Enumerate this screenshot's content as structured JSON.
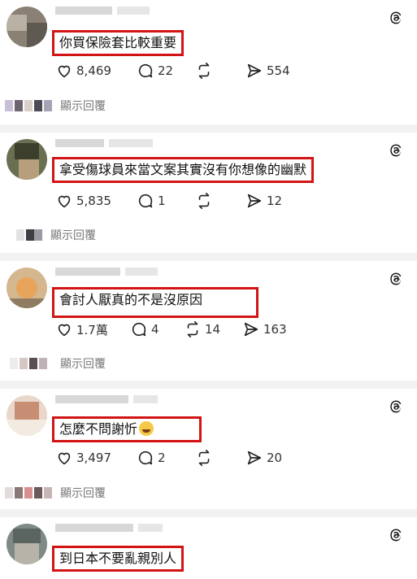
{
  "posts": [
    {
      "caption": "你買保險套比較重要",
      "likes": "8,469",
      "comments": "22",
      "shares": "554",
      "reply_label": "顯示回覆"
    },
    {
      "caption": "拿受傷球員來當文案其實沒有你想像的幽默",
      "likes": "5,835",
      "comments": "1",
      "shares": "12",
      "reply_label": "顯示回覆"
    },
    {
      "caption": "會討人厭真的不是沒原因",
      "likes": "1.7萬",
      "comments": "4",
      "reposts": "14",
      "shares": "163",
      "reply_label": "顯示回覆"
    },
    {
      "caption": "怎麼不問謝忻",
      "emoji": "face-with-tears-of-joy",
      "likes": "3,497",
      "comments": "2",
      "shares": "20",
      "reply_label": "顯示回覆"
    },
    {
      "caption": "到日本不要亂親別人"
    }
  ],
  "colors": {
    "highlight_border": "#d21414",
    "divider": "#f2f2f2",
    "muted_text": "#777777"
  }
}
